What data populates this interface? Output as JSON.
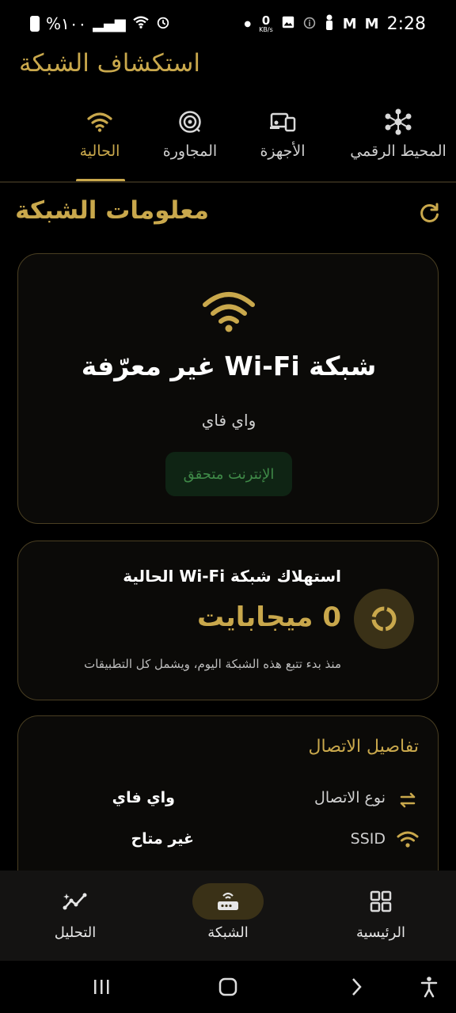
{
  "status_bar": {
    "battery_text": "%١٠٠",
    "speed_value": "0",
    "speed_unit": "KB/s",
    "time": "2:28"
  },
  "app": {
    "title": "استكشاف الشبكة"
  },
  "tabs": [
    {
      "label": "المحيط الرقمي",
      "icon": "hub-icon",
      "active": false
    },
    {
      "label": "الأجهزة",
      "icon": "devices-icon",
      "active": false
    },
    {
      "label": "المجاورة",
      "icon": "radar-icon",
      "active": false
    },
    {
      "label": "الحالية",
      "icon": "wifi-icon",
      "active": true
    }
  ],
  "section": {
    "title": "معلومات الشبكة",
    "refresh_icon": "refresh-icon"
  },
  "network_card": {
    "title": "شبكة Wi-Fi غير معرّفة",
    "subtitle": "واي فاي",
    "badge": "الإنترنت متحقق"
  },
  "usage_card": {
    "title": "استهلاك شبكة Wi-Fi الحالية",
    "value": "0 ميجابايت",
    "note": "منذ بدء تتبع هذه الشبكة اليوم، ويشمل كل التطبيقات"
  },
  "details_card": {
    "title": "تفاصيل الاتصال",
    "rows": [
      {
        "label": "نوع الاتصال",
        "value": "واي فاي",
        "icon": "swap-icon"
      },
      {
        "label": "SSID",
        "value": "غير متاح",
        "icon": "wifi-icon"
      }
    ]
  },
  "bottom_nav": [
    {
      "label": "الرئيسية",
      "icon": "dashboard-icon",
      "active": false
    },
    {
      "label": "الشبكة",
      "icon": "router-icon",
      "active": true
    },
    {
      "label": "التحليل",
      "icon": "analytics-icon",
      "active": false
    }
  ],
  "colors": {
    "accent": "#c9a84c",
    "background": "#000000",
    "card_border": "#4a3f22",
    "badge_bg": "#0f2414",
    "badge_text": "#3f8a48"
  }
}
